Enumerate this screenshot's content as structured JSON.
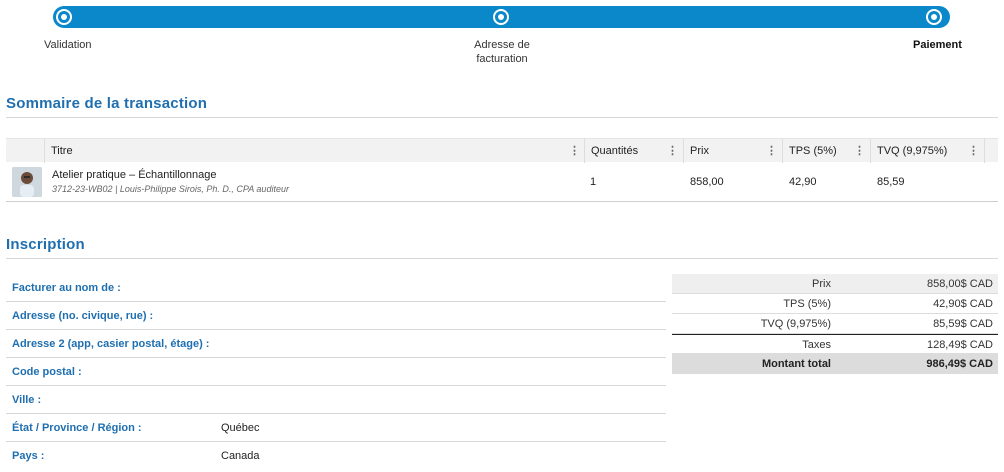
{
  "stepper": {
    "steps": [
      {
        "label": "Validation",
        "current": false
      },
      {
        "label": "Adresse de\nfacturation",
        "label_line1": "Adresse de",
        "label_line2": "facturation",
        "current": false
      },
      {
        "label": "Paiement",
        "current": true
      }
    ],
    "accent": "#0a88c9"
  },
  "summary": {
    "title": "Sommaire de la transaction",
    "columns": [
      "Titre",
      "Quantités",
      "Prix",
      "TPS (5%)",
      "TVQ (9,975%)"
    ],
    "rows": [
      {
        "title": "Atelier pratique – Échantillonnage",
        "subtitle": "3712-23-WB02 | Louis-Philippe Sirois, Ph. D., CPA auditeur",
        "quantity": "1",
        "price": "858,00",
        "tps": "42,90",
        "tvq": "85,59"
      }
    ]
  },
  "inscription": {
    "title": "Inscription",
    "fields": [
      {
        "label": "Facturer au nom de :",
        "value": ""
      },
      {
        "label": "Adresse (no. civique, rue) :",
        "value": ""
      },
      {
        "label": "Adresse 2 (app, casier postal, étage) :",
        "value": ""
      },
      {
        "label": "Code postal :",
        "value": ""
      },
      {
        "label": "Ville :",
        "value": ""
      },
      {
        "label": "État / Province / Région :",
        "value": "Québec"
      },
      {
        "label": "Pays :",
        "value": "Canada"
      }
    ]
  },
  "totals": {
    "rows": [
      {
        "label": "Prix",
        "value": "858,00$ CAD"
      },
      {
        "label": "TPS (5%)",
        "value": "42,90$ CAD"
      },
      {
        "label": "TVQ (9,975%)",
        "value": "85,59$ CAD"
      },
      {
        "label": "Taxes",
        "value": "128,49$ CAD"
      },
      {
        "label": "Montant total",
        "value": "986,49$ CAD"
      }
    ],
    "heading_color": "#1f6fb0"
  }
}
